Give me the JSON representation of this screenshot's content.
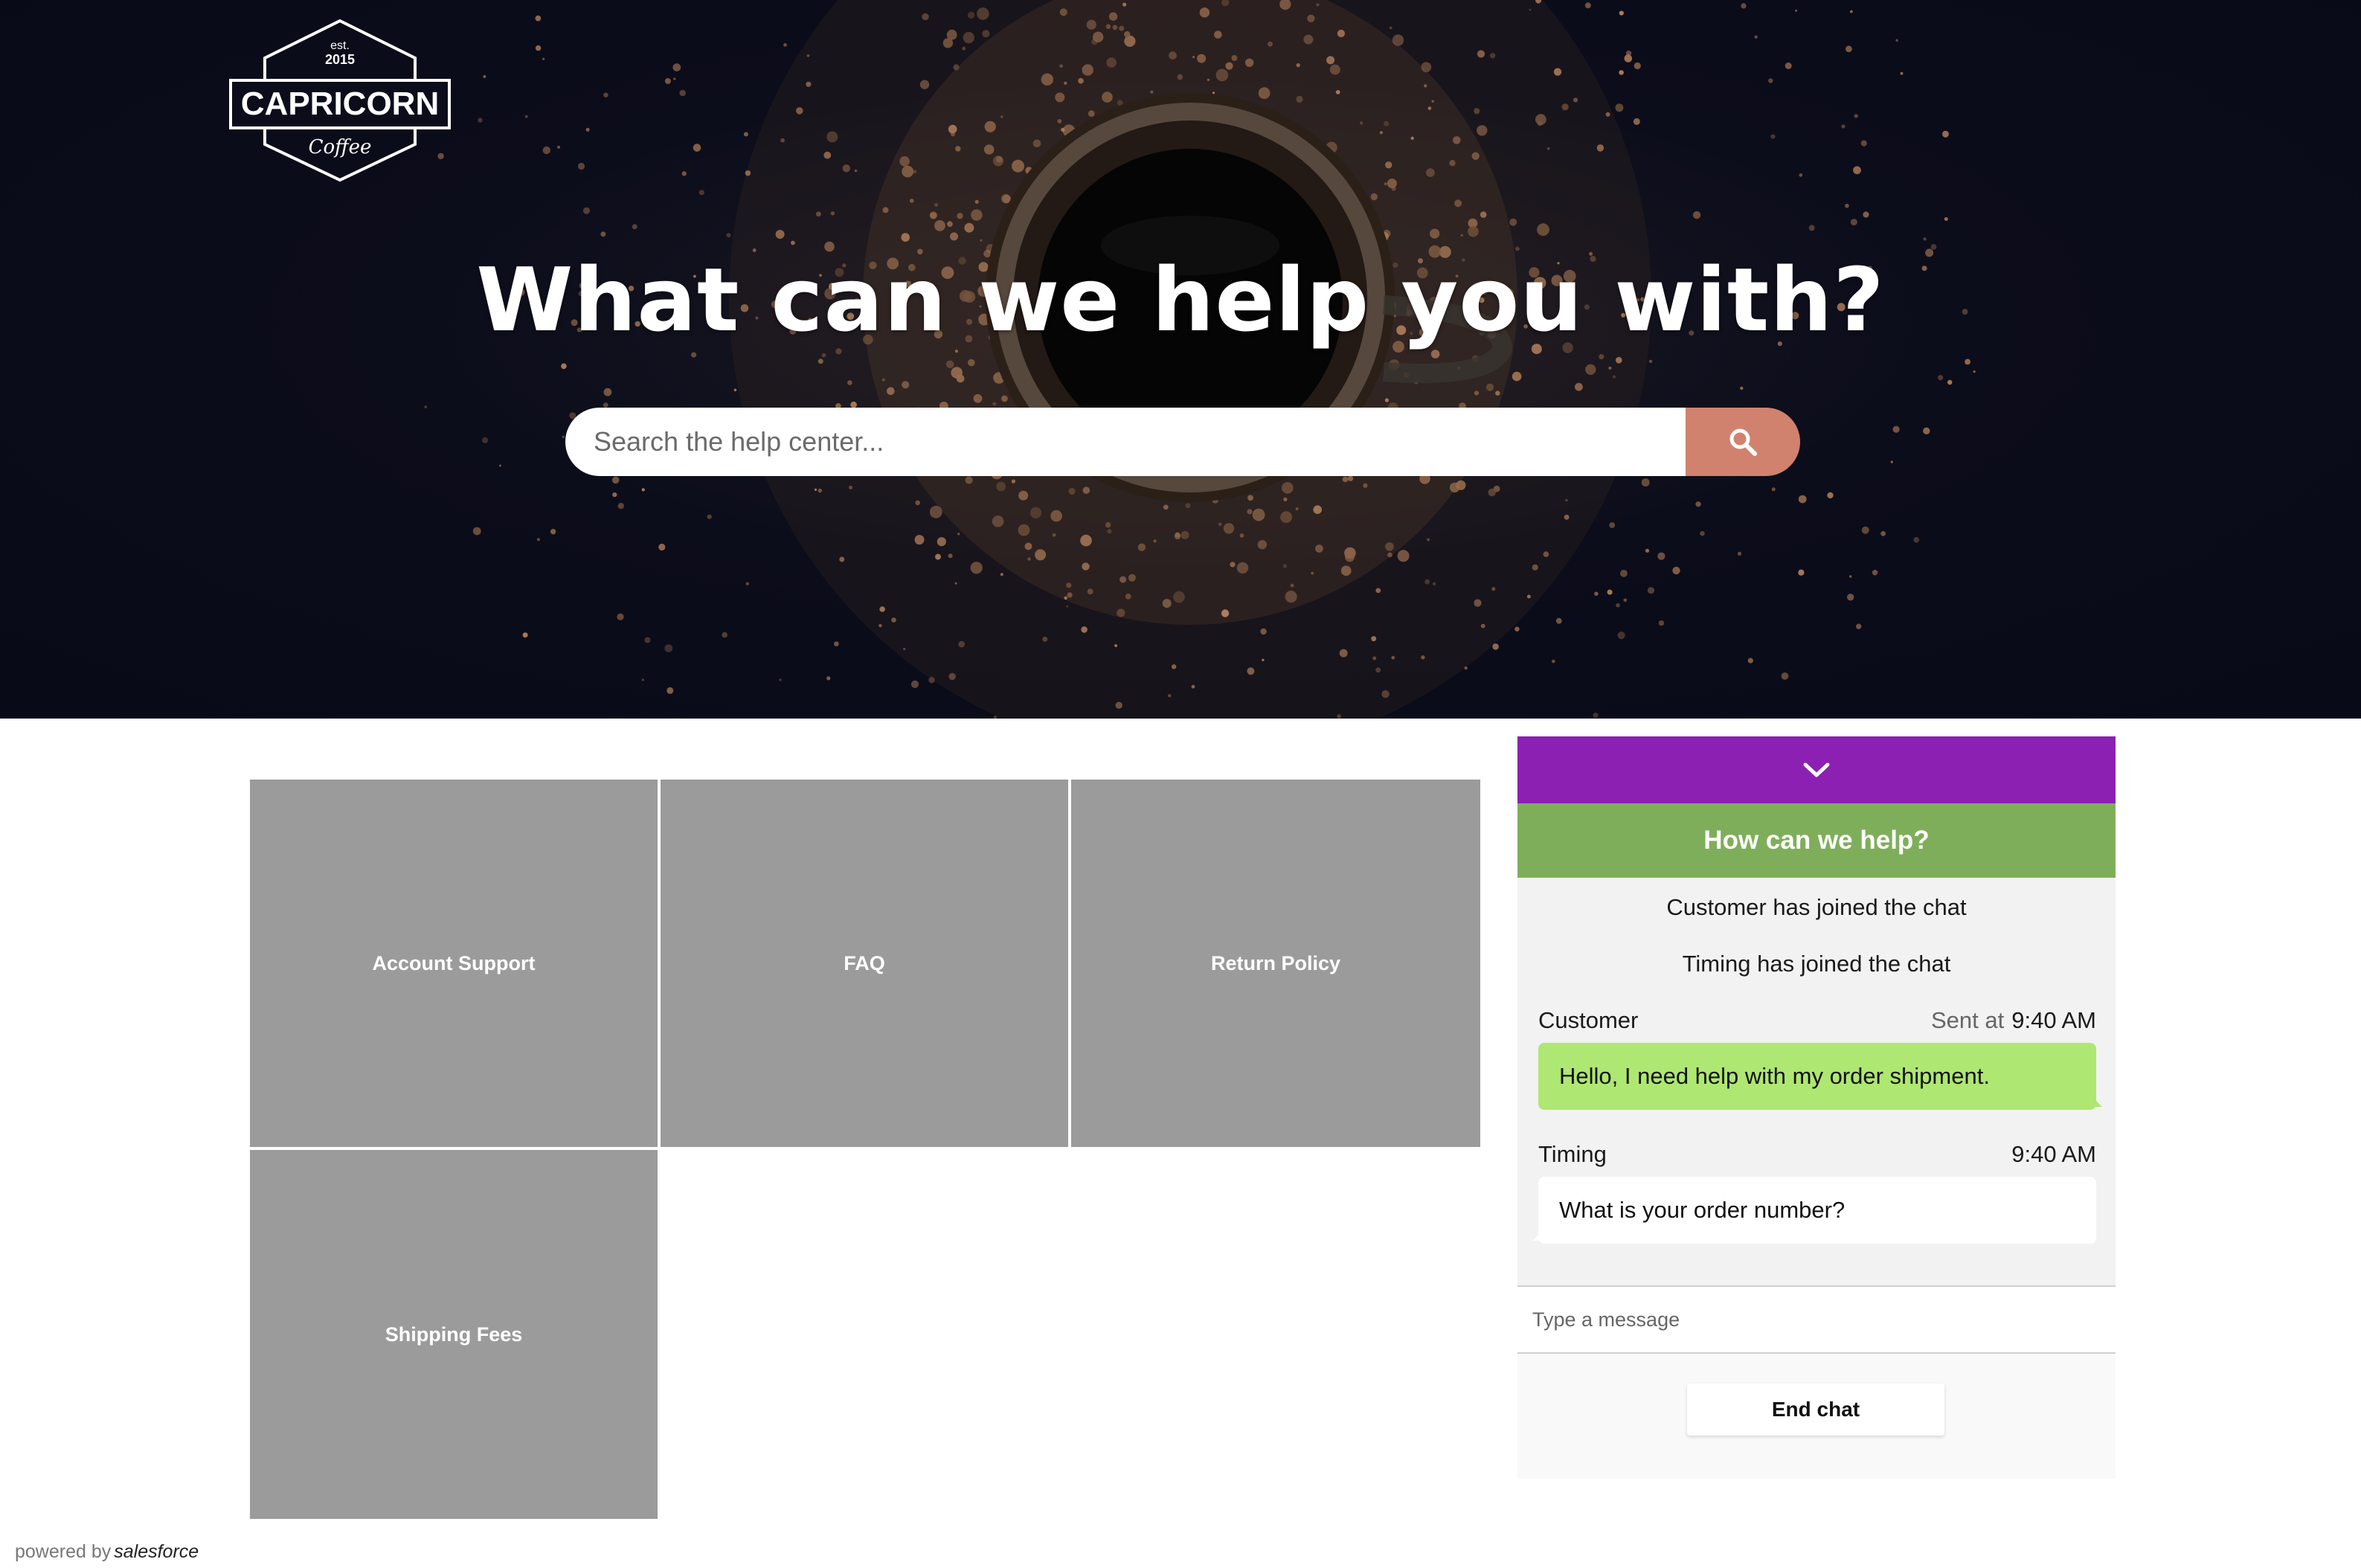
{
  "hero": {
    "logo": {
      "est": "est.",
      "year": "2015",
      "name": "CAPRICORN",
      "tagline": "Coffee"
    },
    "title": "What can we help you with?",
    "search": {
      "placeholder": "Search the help center...",
      "value": "",
      "button_icon": "search-icon",
      "button_color": "#d0826e"
    }
  },
  "tiles": [
    {
      "label": "Account Support"
    },
    {
      "label": "FAQ"
    },
    {
      "label": "Return Policy"
    },
    {
      "label": "Shipping Fees"
    }
  ],
  "chat": {
    "collapse_icon": "chevron-down-icon",
    "header_title": "How can we help?",
    "system_messages": [
      "Customer has joined the chat",
      "Timing has joined the chat"
    ],
    "messages": [
      {
        "sender": "Customer",
        "sent_label": "Sent at",
        "time": "9:40 AM",
        "text": "Hello, I need help with my order shipment.",
        "direction": "outgoing"
      },
      {
        "sender": "Timing",
        "time": "9:40 AM",
        "text": "What is your order number?",
        "direction": "incoming"
      }
    ],
    "input_placeholder": "Type a message",
    "end_chat_label": "End chat",
    "colors": {
      "top_bar": "#8b20b2",
      "header": "#7fae5b",
      "outgoing_bubble": "#aee772"
    }
  },
  "footer": {
    "powered_by": "powered by",
    "brand": "salesforce"
  }
}
